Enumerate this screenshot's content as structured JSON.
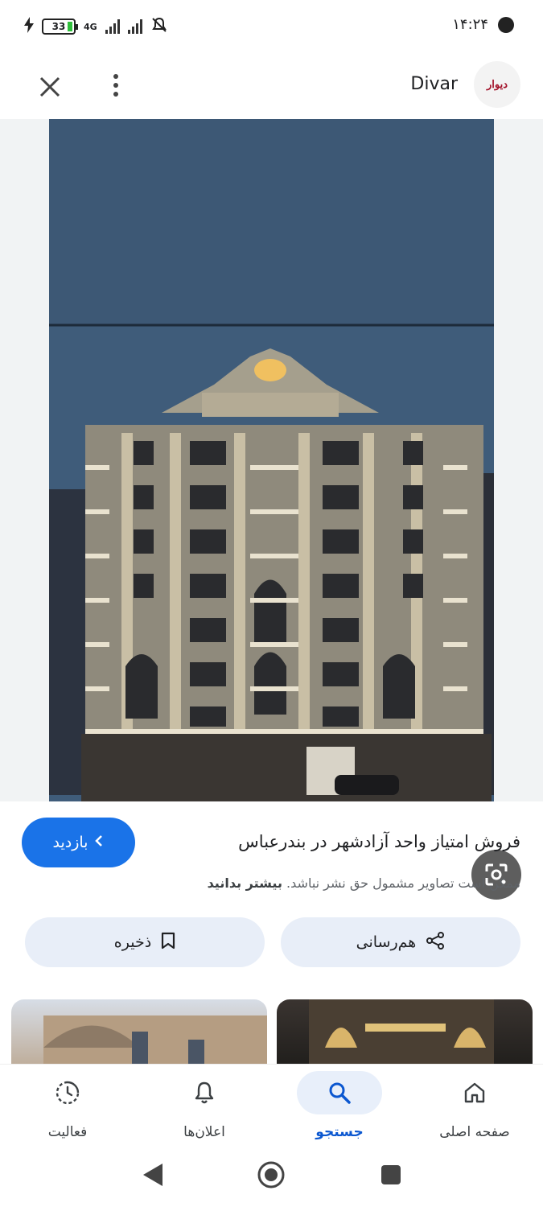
{
  "status_bar": {
    "time": "۱۴:۲۴",
    "battery": "33",
    "network": "4G"
  },
  "app_bar": {
    "title": "Divar",
    "logo_text": "دیوار"
  },
  "result": {
    "visit_label": "بازدید",
    "title": "فروش امتیاز واحد آزادشهر در بندرعباس",
    "copyright_text": "ممکن است تصاویر مشمول حق نشر نباشد.",
    "learn_more": "بیشتر بدانید"
  },
  "actions": {
    "share_label": "هم‌رسانی",
    "save_label": "ذخیره"
  },
  "bottom_nav": {
    "items": [
      {
        "label": "صفحه اصلی",
        "icon": "home-icon"
      },
      {
        "label": "جستجو",
        "icon": "search-icon",
        "active": true
      },
      {
        "label": "اعلان‌ها",
        "icon": "bell-icon"
      },
      {
        "label": "فعالیت",
        "icon": "activity-icon"
      }
    ]
  },
  "colors": {
    "accent": "#1a73e8",
    "chip_bg": "#e8eef8",
    "logo_red": "#a3122a"
  }
}
